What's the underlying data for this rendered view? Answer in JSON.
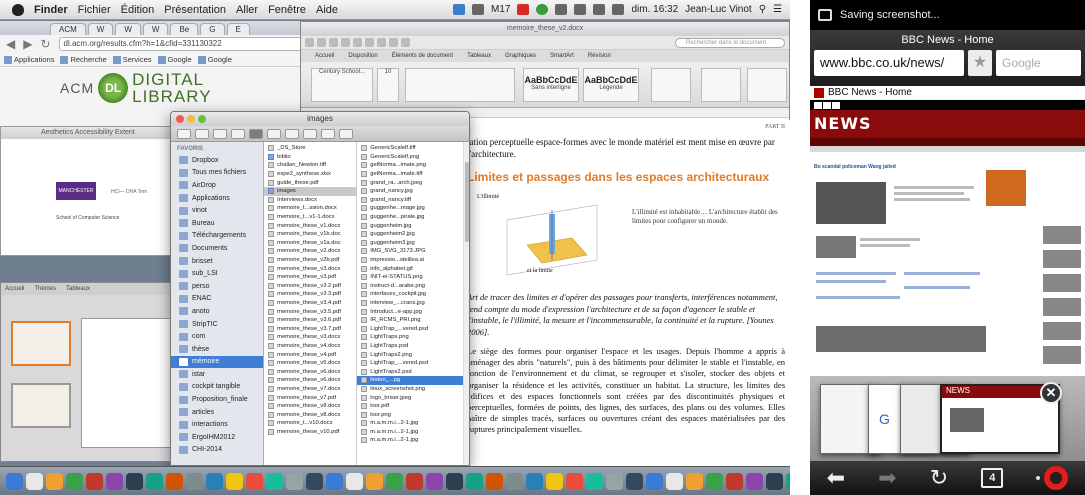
{
  "mac": {
    "menubar": {
      "items": [
        "Finder",
        "Fichier",
        "Édition",
        "Présentation",
        "Aller",
        "Fenêtre",
        "Aide"
      ],
      "status": {
        "m17": "M17",
        "datetime": "dim. 16:32",
        "user": "Jean-Luc Vinot"
      }
    },
    "browser": {
      "tabs": [
        "ACM",
        "W",
        "W",
        "W",
        "Be",
        "G",
        "E",
        "G"
      ],
      "url": "dl.acm.org/results.cfm?h=1&cfid=331130322",
      "bookmarks": [
        "Applications",
        "Recherche",
        "Services",
        "Google",
        "Google"
      ],
      "logo_acm": "ACM",
      "logo_dl": "DL",
      "logo_text_1": "DIGITAL",
      "logo_text_2": "LIBRARY"
    },
    "doc_behind": {
      "title": "Aesthetics Accessibility Extent",
      "logo": "MANCHESTER",
      "sub": "School of Computer Science",
      "side": "HCI— DHA Tem"
    },
    "slides": {
      "tabs": [
        "Accueil",
        "Thèmes",
        "Tableaux"
      ]
    },
    "word": {
      "title": "memoire_these_v2.docx",
      "search_placeholder": "Rechercher dans le document",
      "ribbon_tabs": [
        "Accueil",
        "Disposition",
        "Éléments de document",
        "Tableaux",
        "Graphiques",
        "SmartArt",
        "Révision"
      ],
      "font": "Century School...",
      "size": "10",
      "styles": [
        "AaBbCcDdE",
        "AaBbCcDdE"
      ],
      "style_labels": [
        "Sans interligne",
        "Légende"
      ],
      "page": {
        "part": "PART II",
        "p1": "tation perceptuelle espace-formes avec le monde matériel est ment mise en œuvre par l'architecture.",
        "heading": "Limites et passages dans les espaces architecturaux",
        "fig_label_1": "L'illimité",
        "fig_label_2": "et la limite",
        "fig_note": "L'illimité est inhabitable… L'architecture établit des limites pour configurer un monde.",
        "quote": "Art de tracer des limites et d'opérer des passages pour transferts, interférences notamment, rend compte du mode d'expression l'architecture et de sa façon d'agencer le stable et l'instable, le l'illimité, la mesure et l'incommensurable, la continuité et la rupture. [Younes 2006].",
        "body": "Le siège des formes pour organiser l'espace et les usages. Depuis l'homme a appris à aménager des abris \"naturels\", puis à des bâtiments pour délimiter le stable et l'instable, en fonction de l'environnement et du climat, se regrouper et s'isoler, stocker des objets et organiser la résidence et les activités, constituer un habitat. La structure, les limites des édifices et des espaces fonctionnels sont créées par des discontinuités physiques et perceptuelles, formées de points, des lignes, des surfaces, des plans ou des volumes. Elles naître de simples tracés, surfaces ou ouvertures créant des espaces matérialisées par des ruptures principalement visuelles."
      }
    },
    "finder": {
      "title": "images",
      "sidebar_heading": "FAVORIS",
      "sidebar": [
        "Dropbox",
        "Tous mes fichiers",
        "AirDrop",
        "Applications",
        "vinot",
        "Bureau",
        "Téléchargements",
        "Documents",
        "brisset",
        "sub_LSI",
        "perso",
        "ENAC",
        "anoto",
        "StripTIC",
        "com",
        "thèse",
        "mémoire",
        "istar",
        "cockpit tangible",
        "Proposition_finale",
        "articles",
        "interactions",
        "ErgoIHM2012",
        "CHI-2014"
      ],
      "sidebar_active": 16,
      "col1": [
        "_DS_Store",
        "biblio",
        "challan_Newton.tiff",
        "espe2_synthese.xlsx",
        "guide_these.pdf",
        "images",
        "Interviews.docx",
        "memoire_t...ssion.docx",
        "memoire_t...v1-1.docx",
        "memoire_these_v1.docx",
        "memoire_these_v1b.doc",
        "memoire_these_v1a.doc",
        "memoire_these_v2.docx",
        "memoire_these_v2b.pdf",
        "memoire_these_v3.docx",
        "memoire_these_v3.pdf",
        "memoire_these_v3.2.pdf",
        "memoire_these_v3.3.pdf",
        "memoire_these_v3.4.pdf",
        "memoire_these_v3.5.pdf",
        "memoire_these_v3.6.pdf",
        "memoire_these_v3.7.pdf",
        "memoire_these_v3.docx",
        "memoire_these_v4.docx",
        "memoire_these_v4.pdf",
        "memoire_these_v5.docx",
        "memoire_these_v6.docx",
        "memoire_these_v6.docx",
        "memoire_these_v7.docx",
        "memoire_these_v7.pdf",
        "memoire_these_v8.docx",
        "memoire_these_v8.docx",
        "memoire_t...v10.docx",
        "memoire_these_v10.pdf"
      ],
      "col1_selected": 5,
      "col2": [
        "GenericScalelf.tiff",
        "GenericScalelf.png",
        "getNorma...imate.png",
        "getNorma...imate.tiff",
        "grand_ra...arch.jpeg",
        "grand_nancy.jpg",
        "grand_nancy.tiff",
        "guggenhe...mage.jpg",
        "guggenhe...pirale.jpg",
        "guggenheim.jpg",
        "guggenheim2.jpg",
        "guggenheim3.jpg",
        "IMG_SVG_3173.JPG",
        "impressio...steillea.ai",
        "info_alphabet.gif",
        "INIT-ei-STATUS.png",
        "instruct-d...arabe.png",
        "interfaces_cockpit.jpg",
        "interview_...crans.jpg",
        "Introduct...e-app.jpg",
        "IR_RCMS_PRI.png",
        "LightTrap_...vered.psd",
        "LightTraps.png",
        "LightTraps.psd",
        "LightTraps2.png",
        "LightTrap_...vered.psd",
        "LightTraps2.psd",
        "linden_...pg",
        "linux_screenshot.png",
        "logo_briser.jpeg",
        "loor.pdf",
        "loor.png",
        "m.a.m.m.i...2-1.jpg",
        "m.a.m.m.i...2-1.jpg",
        "m.a.m.m.i...2-1.jpg"
      ],
      "col2_selected": 27
    }
  },
  "phone": {
    "status": "Saving screenshot...",
    "page_title": "BBC News - Home",
    "url": "www.bbc.co.uk/news/",
    "search_placeholder": "Google",
    "page_header": "BBC News - Home",
    "bbc_logo": "BBC",
    "news_label": "NEWS",
    "headline": "Bo scandal policeman Wang jailed",
    "tab_count": "4",
    "colors": {
      "bbc_red": "#8a0b0b",
      "opera_red": "#e41c1c"
    }
  }
}
